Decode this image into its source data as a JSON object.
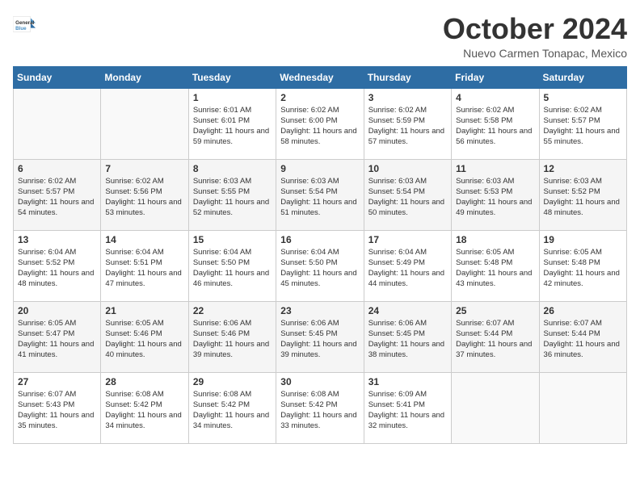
{
  "header": {
    "logo": {
      "line1": "General",
      "line2": "Blue"
    },
    "title": "October 2024",
    "location": "Nuevo Carmen Tonapac, Mexico"
  },
  "weekdays": [
    "Sunday",
    "Monday",
    "Tuesday",
    "Wednesday",
    "Thursday",
    "Friday",
    "Saturday"
  ],
  "weeks": [
    [
      {
        "day": "",
        "content": ""
      },
      {
        "day": "",
        "content": ""
      },
      {
        "day": "1",
        "content": "Sunrise: 6:01 AM\nSunset: 6:01 PM\nDaylight: 11 hours and 59 minutes."
      },
      {
        "day": "2",
        "content": "Sunrise: 6:02 AM\nSunset: 6:00 PM\nDaylight: 11 hours and 58 minutes."
      },
      {
        "day": "3",
        "content": "Sunrise: 6:02 AM\nSunset: 5:59 PM\nDaylight: 11 hours and 57 minutes."
      },
      {
        "day": "4",
        "content": "Sunrise: 6:02 AM\nSunset: 5:58 PM\nDaylight: 11 hours and 56 minutes."
      },
      {
        "day": "5",
        "content": "Sunrise: 6:02 AM\nSunset: 5:57 PM\nDaylight: 11 hours and 55 minutes."
      }
    ],
    [
      {
        "day": "6",
        "content": "Sunrise: 6:02 AM\nSunset: 5:57 PM\nDaylight: 11 hours and 54 minutes."
      },
      {
        "day": "7",
        "content": "Sunrise: 6:02 AM\nSunset: 5:56 PM\nDaylight: 11 hours and 53 minutes."
      },
      {
        "day": "8",
        "content": "Sunrise: 6:03 AM\nSunset: 5:55 PM\nDaylight: 11 hours and 52 minutes."
      },
      {
        "day": "9",
        "content": "Sunrise: 6:03 AM\nSunset: 5:54 PM\nDaylight: 11 hours and 51 minutes."
      },
      {
        "day": "10",
        "content": "Sunrise: 6:03 AM\nSunset: 5:54 PM\nDaylight: 11 hours and 50 minutes."
      },
      {
        "day": "11",
        "content": "Sunrise: 6:03 AM\nSunset: 5:53 PM\nDaylight: 11 hours and 49 minutes."
      },
      {
        "day": "12",
        "content": "Sunrise: 6:03 AM\nSunset: 5:52 PM\nDaylight: 11 hours and 48 minutes."
      }
    ],
    [
      {
        "day": "13",
        "content": "Sunrise: 6:04 AM\nSunset: 5:52 PM\nDaylight: 11 hours and 48 minutes."
      },
      {
        "day": "14",
        "content": "Sunrise: 6:04 AM\nSunset: 5:51 PM\nDaylight: 11 hours and 47 minutes."
      },
      {
        "day": "15",
        "content": "Sunrise: 6:04 AM\nSunset: 5:50 PM\nDaylight: 11 hours and 46 minutes."
      },
      {
        "day": "16",
        "content": "Sunrise: 6:04 AM\nSunset: 5:50 PM\nDaylight: 11 hours and 45 minutes."
      },
      {
        "day": "17",
        "content": "Sunrise: 6:04 AM\nSunset: 5:49 PM\nDaylight: 11 hours and 44 minutes."
      },
      {
        "day": "18",
        "content": "Sunrise: 6:05 AM\nSunset: 5:48 PM\nDaylight: 11 hours and 43 minutes."
      },
      {
        "day": "19",
        "content": "Sunrise: 6:05 AM\nSunset: 5:48 PM\nDaylight: 11 hours and 42 minutes."
      }
    ],
    [
      {
        "day": "20",
        "content": "Sunrise: 6:05 AM\nSunset: 5:47 PM\nDaylight: 11 hours and 41 minutes."
      },
      {
        "day": "21",
        "content": "Sunrise: 6:05 AM\nSunset: 5:46 PM\nDaylight: 11 hours and 40 minutes."
      },
      {
        "day": "22",
        "content": "Sunrise: 6:06 AM\nSunset: 5:46 PM\nDaylight: 11 hours and 39 minutes."
      },
      {
        "day": "23",
        "content": "Sunrise: 6:06 AM\nSunset: 5:45 PM\nDaylight: 11 hours and 39 minutes."
      },
      {
        "day": "24",
        "content": "Sunrise: 6:06 AM\nSunset: 5:45 PM\nDaylight: 11 hours and 38 minutes."
      },
      {
        "day": "25",
        "content": "Sunrise: 6:07 AM\nSunset: 5:44 PM\nDaylight: 11 hours and 37 minutes."
      },
      {
        "day": "26",
        "content": "Sunrise: 6:07 AM\nSunset: 5:44 PM\nDaylight: 11 hours and 36 minutes."
      }
    ],
    [
      {
        "day": "27",
        "content": "Sunrise: 6:07 AM\nSunset: 5:43 PM\nDaylight: 11 hours and 35 minutes."
      },
      {
        "day": "28",
        "content": "Sunrise: 6:08 AM\nSunset: 5:42 PM\nDaylight: 11 hours and 34 minutes."
      },
      {
        "day": "29",
        "content": "Sunrise: 6:08 AM\nSunset: 5:42 PM\nDaylight: 11 hours and 34 minutes."
      },
      {
        "day": "30",
        "content": "Sunrise: 6:08 AM\nSunset: 5:42 PM\nDaylight: 11 hours and 33 minutes."
      },
      {
        "day": "31",
        "content": "Sunrise: 6:09 AM\nSunset: 5:41 PM\nDaylight: 11 hours and 32 minutes."
      },
      {
        "day": "",
        "content": ""
      },
      {
        "day": "",
        "content": ""
      }
    ]
  ]
}
